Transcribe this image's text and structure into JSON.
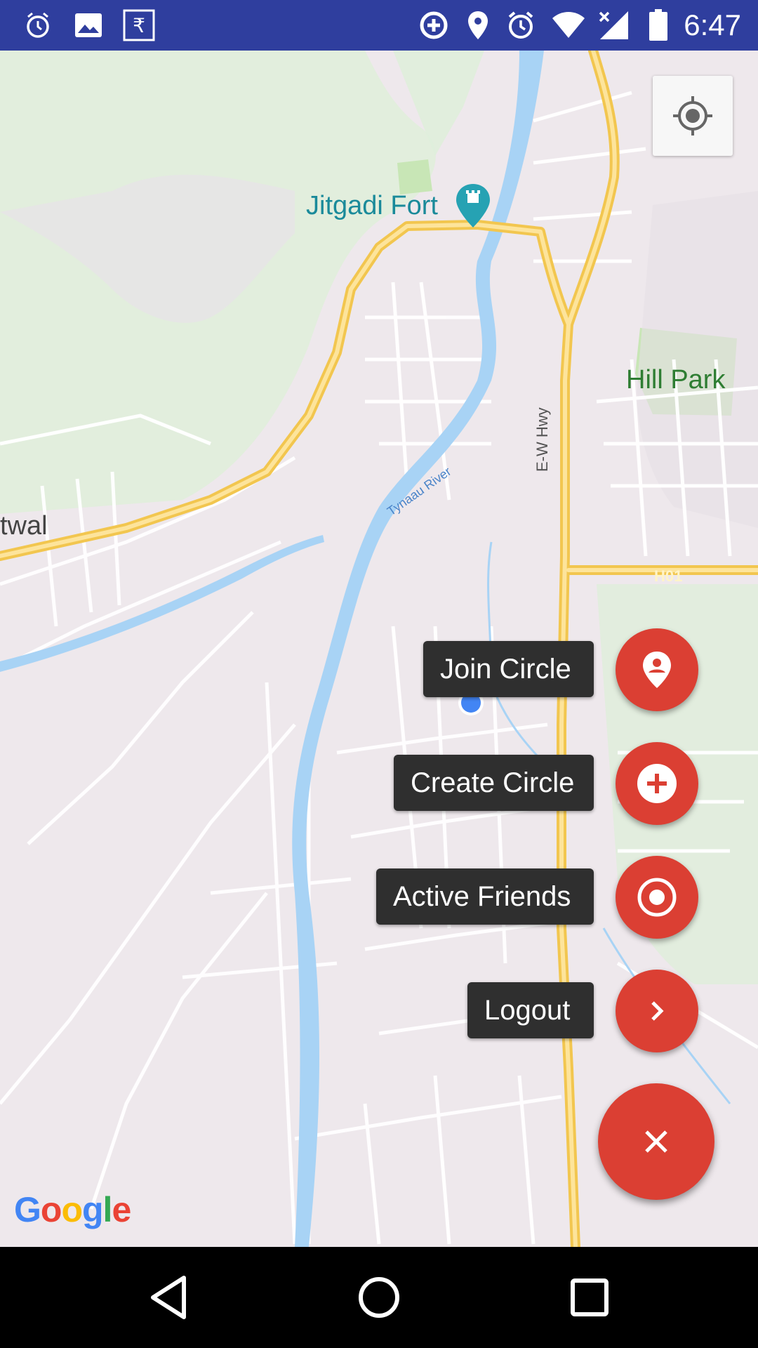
{
  "status_bar": {
    "time": "6:47",
    "icons": [
      "alarm-icon",
      "image-icon",
      "rupee-icon",
      "data-saver-icon",
      "location-icon",
      "alarm-icon",
      "wifi-icon",
      "signal-icon",
      "battery-icon"
    ],
    "background": "#2f3e9e"
  },
  "map": {
    "labels": {
      "fort": "Jitgadi Fort",
      "park": "Hill Park",
      "highway": "E-W Hwy",
      "highway_code": "H01",
      "river": "Tynaau River",
      "town": "twal"
    },
    "attribution": "Google"
  },
  "fab_menu": {
    "items": [
      {
        "label": "Join Circle",
        "icon": "person-pin-icon"
      },
      {
        "label": "Create Circle",
        "icon": "add-circle-icon"
      },
      {
        "label": "Active Friends",
        "icon": "radio-target-icon"
      },
      {
        "label": "Logout",
        "icon": "chevron-right-icon"
      }
    ],
    "main_icon": "close-icon",
    "accent": "#db3f33"
  },
  "nav_bar": {
    "buttons": [
      "back-icon",
      "home-icon",
      "recents-icon"
    ]
  }
}
